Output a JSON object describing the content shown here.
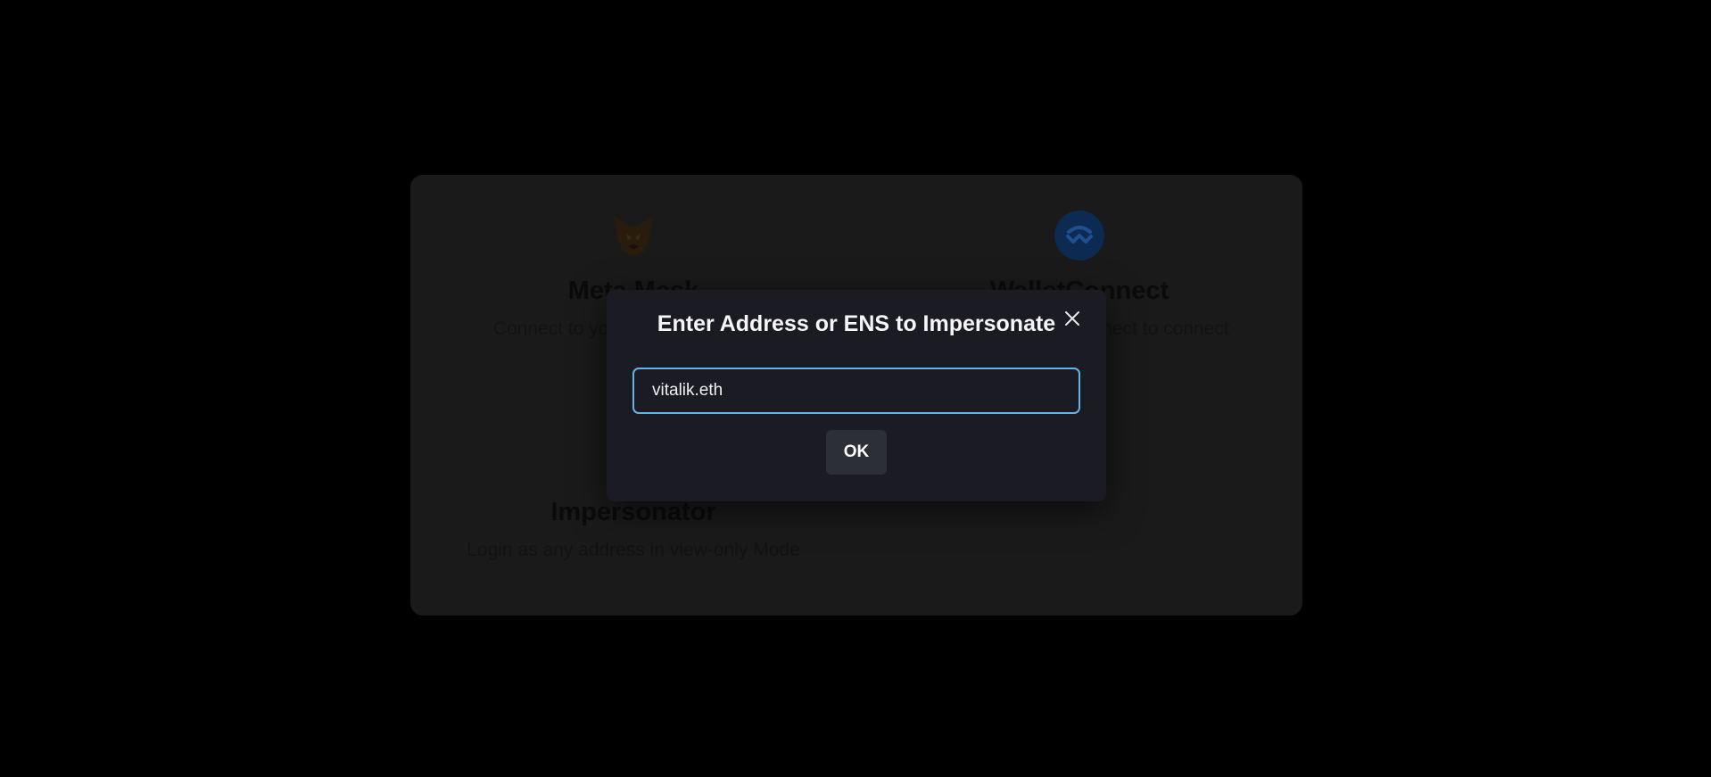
{
  "wallets": [
    {
      "name": "MetaMask",
      "visible_name": "Meta Mask",
      "description": "Connect to your MetaMask Wallet",
      "icon": "metamask-fox-icon"
    },
    {
      "name": "WalletConnect",
      "visible_name": "WalletConnect",
      "description": "Scan with WalletConnect to connect",
      "icon": "walletconnect-icon"
    },
    {
      "name": "Impersonator",
      "visible_name": "Impersonator",
      "description": "Login as any address in view-only Mode",
      "icon": ""
    }
  ],
  "modal": {
    "title": "Enter Address or ENS to Impersonate",
    "input_value": "vitalik.eth",
    "ok_label": "OK",
    "close_icon": "close-icon"
  },
  "colors": {
    "page_background": "#000000",
    "card_background": "#1a1a1a",
    "modal_background": "#1a1b23",
    "input_focus_border": "#63b3ed",
    "ok_button_background": "#2d2f36",
    "walletconnect_blue": "#1d4f91",
    "metamask_orange": "#3a2a12"
  }
}
